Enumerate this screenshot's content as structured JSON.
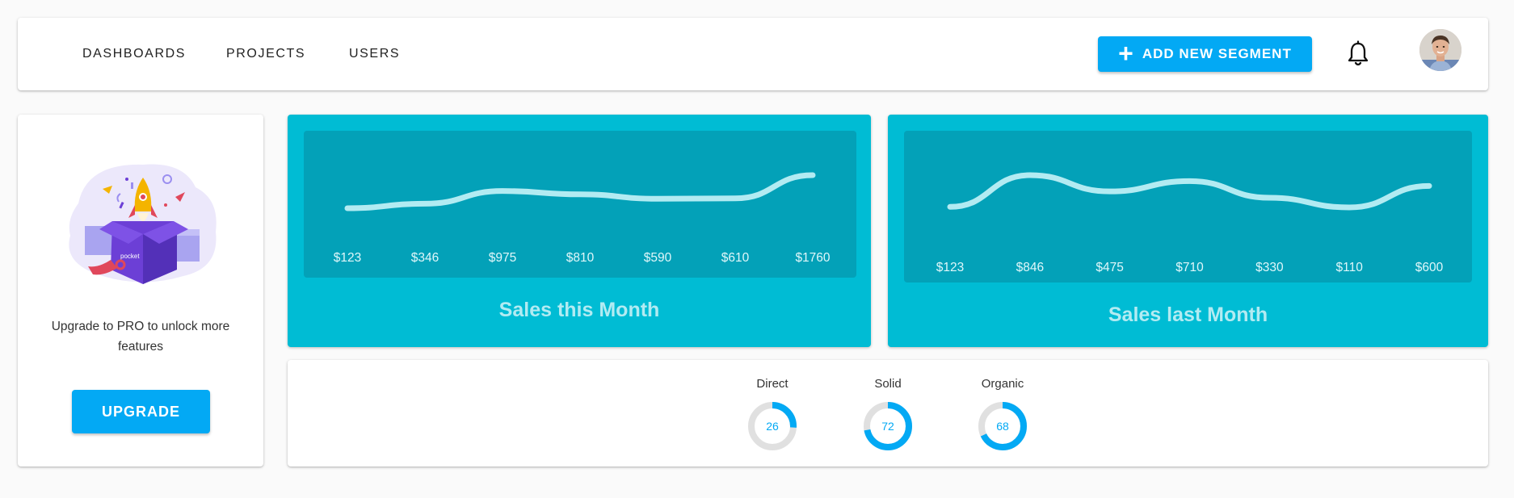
{
  "nav": {
    "items": [
      {
        "label": "DASHBOARDS"
      },
      {
        "label": "PROJECTS"
      },
      {
        "label": "USERS"
      }
    ]
  },
  "toolbar": {
    "add_segment_label": "ADD NEW SEGMENT",
    "add_icon": "plus-icon",
    "bell_icon": "bell-icon",
    "avatar": "user-avatar"
  },
  "upgrade": {
    "text": "Upgrade to PRO to unlock more features",
    "button_label": "UPGRADE"
  },
  "colors": {
    "accent": "#03a9f4",
    "chart_bg": "#00bcd4",
    "chart_inner": "#03a1b8",
    "chart_text": "#b2ebf2",
    "donut_track": "#e0e0e0"
  },
  "chart_data": [
    {
      "type": "line",
      "title": "Sales this Month",
      "categories": [
        "$123",
        "$346",
        "$975",
        "$810",
        "$590",
        "$610",
        "$1760"
      ],
      "values": [
        123,
        346,
        975,
        810,
        590,
        610,
        1760
      ],
      "grid": false
    },
    {
      "type": "line",
      "title": "Sales last Month",
      "categories": [
        "$123",
        "$846",
        "$475",
        "$710",
        "$330",
        "$110",
        "$600"
      ],
      "values": [
        123,
        846,
        475,
        710,
        330,
        110,
        600
      ],
      "grid": false
    }
  ],
  "donuts": [
    {
      "label": "Direct",
      "value": 26
    },
    {
      "label": "Solid",
      "value": 72
    },
    {
      "label": "Organic",
      "value": 68
    }
  ]
}
